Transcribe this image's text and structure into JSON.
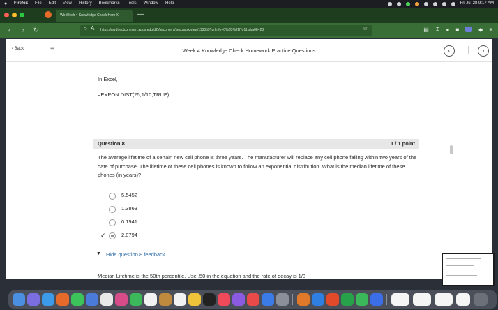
{
  "menubar": {
    "app_name": "Firefox",
    "items": [
      "File",
      "Edit",
      "View",
      "History",
      "Bookmarks",
      "Tools",
      "Window",
      "Help"
    ],
    "clock": "Fri Jul 28  9:17 AM"
  },
  "tab": {
    "title": "Wk Week 4 Knowledge Check Hom X"
  },
  "toolbar": {
    "url": "https://mydirectcommon.apus.edu/d2l/le/content/seq.aspx/view/113559?urlInfo=0%2B%2BTo11 sba08=23"
  },
  "page": {
    "back_label": "Back",
    "title": "Week 4 Knowledge Check Homework Practice Questions"
  },
  "content": {
    "line_excel": "In Excel,",
    "formula": "=EXPON.DIST(25,1/10,TRUE)",
    "question_number": "Question 8",
    "question_points": "1 / 1 point",
    "question_text": "The average lifetime of a certain new cell phone is three years. The manufacturer will replace any cell phone failing within two years of the date of purchase. The lifetime of these cell phones is known to follow an exponential distribution. What is the median lifetime of these phones (in years)?",
    "options": [
      "5.5452",
      "1.3863",
      "0.1941",
      "2.0794"
    ],
    "selected_option": "2.0794",
    "feedback_toggle": "Hide question 8 feedback",
    "feedback_text": "Median Lifetime is the 50th percentile. Use .50 in the equation and the rate of decay is 1/3"
  }
}
